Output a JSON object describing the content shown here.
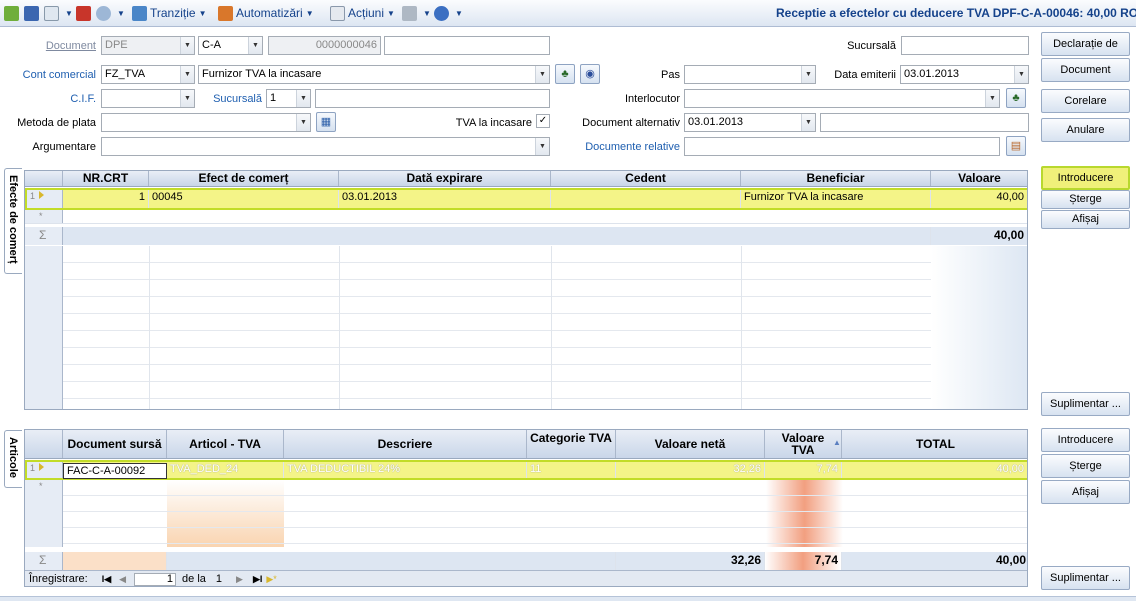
{
  "toolbar": {
    "tranzitie": "Tranziție",
    "automatizari": "Automatizări",
    "actiuni": "Acțiuni",
    "window_title": "Receptie a efectelor cu deducere TVA DPF-C-A-00046: 40,00 RO"
  },
  "form": {
    "document_label": "Document",
    "document_type": "DPE",
    "document_series": "C-A",
    "document_number": "0000000046",
    "document_extra": "",
    "sucursala_label": "Sucursală",
    "sucursala_value": "",
    "cont_comercial_label": "Cont comercial",
    "cont_comercial_code": "FZ_TVA",
    "cont_comercial_name": "Furnizor TVA la incasare",
    "pas_label": "Pas",
    "pas_value": "",
    "data_emiterii_label": "Data emiterii",
    "data_emiterii_value": "03.01.2013",
    "cif_label": "C.I.F.",
    "cif_value": "",
    "sucursala2_label": "Sucursală",
    "sucursala2_value": "1",
    "sucursala2_name": "",
    "interlocutor_label": "Interlocutor",
    "interlocutor_value": "",
    "metoda_plata_label": "Metoda de plata",
    "metoda_plata_value": "",
    "tva_incasare_label": "TVA la incasare",
    "tva_incasare_checked": "✓",
    "doc_alternativ_label": "Document alternativ",
    "doc_alternativ_date": "03.01.2013",
    "doc_alternativ_value": "",
    "argumentare_label": "Argumentare",
    "argumentare_value": "",
    "documente_relative_label": "Documente relative",
    "documente_relative_value": ""
  },
  "side_buttons": {
    "declaratie": "Declarație de",
    "document": "Document",
    "corelare": "Corelare",
    "anulare": "Anulare",
    "introducere1": "Introducere",
    "sterge1": "Șterge",
    "afisaj1": "Afișaj",
    "suplimentar1": "Suplimentar ...",
    "introducere2": "Introducere",
    "sterge2": "Șterge",
    "afisaj2": "Afișaj",
    "suplimentar2": "Suplimentar ..."
  },
  "tabs": {
    "efecte": "Efecte de comerț",
    "articole": "Articole"
  },
  "grid1": {
    "headers": [
      "NR.CRT",
      "Efect de comerț",
      "Dată expirare",
      "Cedent",
      "Beneficiar",
      "Valoare"
    ],
    "row": {
      "indicator": "1",
      "nr": "1",
      "efect": "00045",
      "data": "03.01.2013",
      "cedent": "",
      "beneficiar": "Furnizor TVA la incasare",
      "valoare": "40,00"
    },
    "sum": "40,00",
    "sigma": "Σ",
    "star": "*"
  },
  "grid2": {
    "headers": [
      "Document sursă",
      "Articol - TVA",
      "Descriere",
      "Categorie TVA",
      "Valoare netă",
      "Valoare TVA",
      "TOTAL"
    ],
    "row": {
      "indicator": "1",
      "doc": "FAC-C-A-00092",
      "articol": "TVA_DED_24",
      "descriere": "TVA DEDUCTIBIL 24%",
      "categorie": "11",
      "neta": "32,26",
      "tva": "7,74",
      "total": "40,00"
    },
    "sum": {
      "neta": "32,26",
      "tva": "7,74",
      "total": "40,00"
    },
    "sigma": "Σ",
    "star": "*"
  },
  "nav": {
    "label": "Înregistrare:",
    "current": "1",
    "of_label": "de la",
    "total": "1"
  }
}
